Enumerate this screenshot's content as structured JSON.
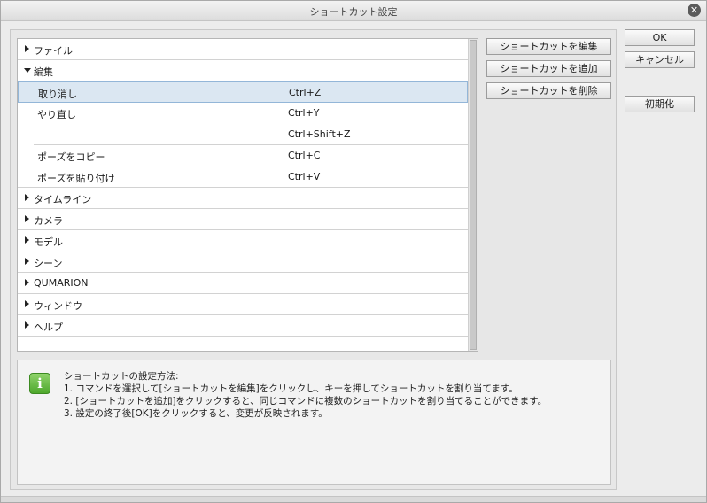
{
  "window": {
    "title": "ショートカット設定"
  },
  "tree": {
    "categories": [
      {
        "label": "ファイル"
      },
      {
        "label": "編集"
      },
      {
        "label": "タイムライン"
      },
      {
        "label": "カメラ"
      },
      {
        "label": "モデル"
      },
      {
        "label": "シーン"
      },
      {
        "label": "QUMARION"
      },
      {
        "label": "ウィンドウ"
      },
      {
        "label": "ヘルプ"
      }
    ],
    "commands": [
      {
        "label": "取り消し",
        "shortcut": "Ctrl+Z",
        "selected": true
      },
      {
        "label": "やり直し",
        "shortcut": "Ctrl+Y"
      },
      {
        "label": "",
        "shortcut": "Ctrl+Shift+Z"
      },
      {
        "label": "ポーズをコピー",
        "shortcut": "Ctrl+C"
      },
      {
        "label": "ポーズを貼り付け",
        "shortcut": "Ctrl+V"
      }
    ]
  },
  "actions": {
    "edit": "ショートカットを編集",
    "add": "ショートカットを追加",
    "delete": "ショートカットを削除"
  },
  "dialog_buttons": {
    "ok": "OK",
    "cancel": "キャンセル",
    "reset": "初期化"
  },
  "info": {
    "icon": "info-icon",
    "heading": "ショートカットの設定方法:",
    "lines": [
      "1. コマンドを選択して[ショートカットを編集]をクリックし、キーを押してショートカットを割り当てます。",
      "2. [ショートカットを追加]をクリックすると、同じコマンドに複数のショートカットを割り当てることができます。",
      "3. 設定の終了後[OK]をクリックすると、変更が反映されます。"
    ]
  },
  "colors": {
    "selection": "#dbe7f2",
    "info_icon": "#4ea82c"
  }
}
